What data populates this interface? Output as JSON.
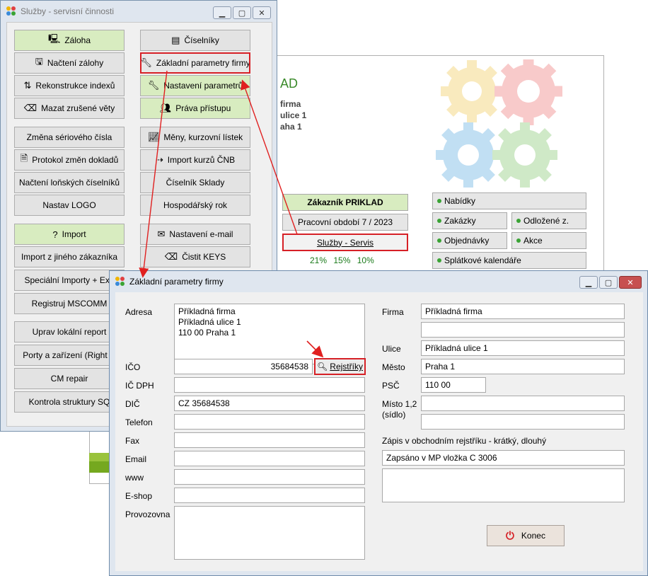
{
  "services_window": {
    "title": "Služby - servisní činnosti",
    "left_buttons": [
      {
        "label": "Záloha",
        "icon": "computer-disk-icon",
        "style": "green"
      },
      {
        "label": "Načtení zálohy",
        "icon": "disk-computer-icon",
        "style": "gray"
      },
      {
        "label": "Rekonstrukce indexů",
        "icon": "sort-az-icon",
        "style": "gray"
      },
      {
        "label": "Mazat zrušené věty",
        "icon": "eraser-icon",
        "style": "gray"
      },
      {
        "label": "Změna sériového čísla",
        "icon": "",
        "style": "gray"
      },
      {
        "label": "Protokol změn dokladů",
        "icon": "document-icon",
        "style": "gray"
      },
      {
        "label": "Načtení loňských číselníků",
        "icon": "",
        "style": "gray"
      },
      {
        "label": "Nastav LOGO",
        "icon": "",
        "style": "gray"
      },
      {
        "label": "Import",
        "icon": "question-computer-icon",
        "style": "green"
      },
      {
        "label": "Import z jiného zákazníka",
        "icon": "",
        "style": "gray"
      },
      {
        "label": "Speciální Importy + Exp",
        "icon": "",
        "style": "gray"
      },
      {
        "label": "Registruj MSCOMM",
        "icon": "",
        "style": "gray"
      },
      {
        "label": "Uprav lokální report",
        "icon": "",
        "style": "gray"
      },
      {
        "label": "Porty a zařízení (Right C",
        "icon": "",
        "style": "gray"
      },
      {
        "label": "CM repair",
        "icon": "",
        "style": "gray"
      },
      {
        "label": "Kontrola struktury SQ",
        "icon": "",
        "style": "gray"
      }
    ],
    "right_buttons": [
      {
        "label": "Číselníky",
        "icon": "book-stack-icon",
        "style": "gray"
      },
      {
        "label": "Základní parametry firmy",
        "icon": "wrench-icon",
        "style": "highlighted"
      },
      {
        "label": "Nastavení parametrů",
        "icon": "wrench-icon",
        "style": "green"
      },
      {
        "label": "Práva přístupu",
        "icon": "users-lock-icon",
        "style": "green"
      },
      {
        "label": "Měny, kurzovní lístek",
        "icon": "chart-line-icon",
        "style": "gray"
      },
      {
        "label": "Import kurzů ČNB",
        "icon": "import-chart-icon",
        "style": "gray"
      },
      {
        "label": "Číselník Sklady",
        "icon": "",
        "style": "gray"
      },
      {
        "label": "Hospodářský rok",
        "icon": "",
        "style": "gray"
      },
      {
        "label": "Nastavení e-mail",
        "icon": "envelope-icon",
        "style": "gray"
      },
      {
        "label": "Čistit KEYS",
        "icon": "eraser-icon",
        "style": "gray"
      }
    ]
  },
  "background_window": {
    "title_fragment": "AD",
    "info_lines": [
      "firma",
      "ulice 1",
      "aha 1"
    ],
    "customer_label": "Zákazník  PRIKLAD",
    "period_label": "Pracovní období  7 / 2023",
    "services_label": "Služby - Servis",
    "percentages": [
      "21%",
      "15%",
      "10%"
    ],
    "menu": {
      "nabidky": "Nabídky",
      "zakazky": "Zakázky",
      "odlozene": "Odložené z.",
      "objednavky": "Objednávky",
      "akce": "Akce",
      "splatkove": "Splátkové kalendáře"
    }
  },
  "dialog": {
    "title": "Základní parametry firmy",
    "labels": {
      "adresa": "Adresa",
      "ico": "IČO",
      "icdph": "IČ DPH",
      "dic": "DIČ",
      "telefon": "Telefon",
      "fax": "Fax",
      "email": "Email",
      "www": "www",
      "eshop": "E-shop",
      "provozovna": "Provozovna",
      "firma": "Firma",
      "ulice": "Ulice",
      "mesto": "Město",
      "psc": "PSČ",
      "misto": "Místo 1,2\n(sídlo)",
      "zapis": "Zápis v obchodním rejstříku - krátký, dlouhý"
    },
    "values": {
      "adresa": "Příkladná firma\nPříkladná ulice 1\n110 00 Praha 1",
      "ico": "35684538",
      "icdph": "",
      "dic": "CZ 35684538",
      "telefon": "",
      "fax": "",
      "email": "",
      "www": "",
      "eshop": "",
      "provozovna": "",
      "firma": "Příkladná firma",
      "firma2": "",
      "ulice": "Příkladná ulice 1",
      "mesto": "Praha 1",
      "psc": "110 00",
      "misto1": "",
      "misto2": "",
      "zapis_kratky": "Zapsáno v MP vložka C 3006",
      "zapis_dlouhy": ""
    },
    "rejstriky_label": "Rejstříky",
    "konec_label": "Konec"
  },
  "colors": {
    "highlight_red": "#d62026",
    "green_button": "#d8ecc0",
    "accent_green": "#3a8a2a"
  }
}
